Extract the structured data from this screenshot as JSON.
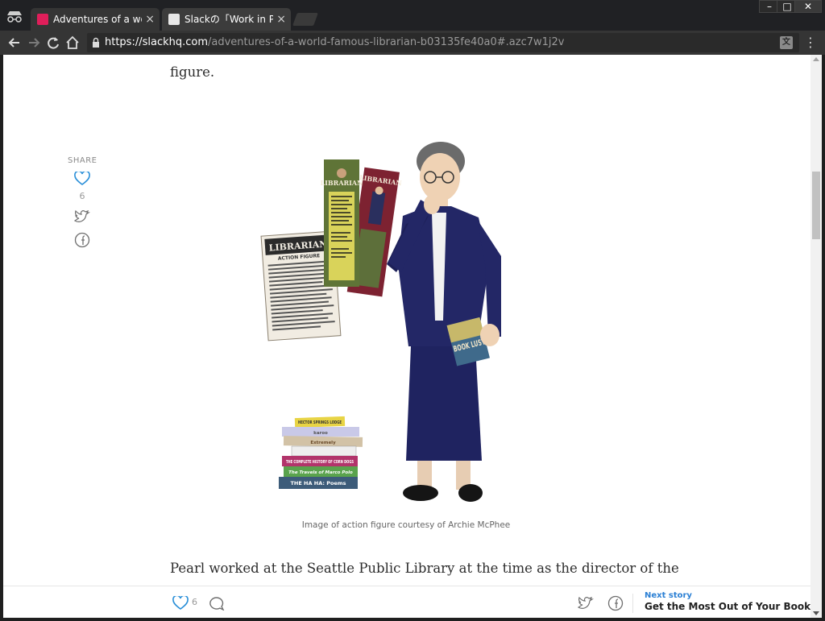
{
  "browser": {
    "tabs": [
      {
        "title": "Adventures of a world-famous librarian",
        "close": "×",
        "active": true
      },
      {
        "title": "Slackの「Work in Progress」",
        "close": "×",
        "active": false
      }
    ],
    "window_controls": {
      "minimize": "–",
      "maximize": "□",
      "close": "✕"
    },
    "url_host": "https://slackhq.com",
    "url_path": "/adventures-of-a-world-famous-librarian-b03135fe40a0#.azc7w1j2v"
  },
  "article": {
    "top_text": "figure.",
    "bottom_text": "Pearl worked at the Seattle Public Library at the time as the director of the",
    "caption": "Image of action figure courtesy of Archie McPhee"
  },
  "image": {
    "card_title": "LIBRARIAN",
    "card_subtitle": "ACTION FIGURE",
    "bookmark_title": "LIBRARIAN",
    "bookmark_title_2": "LIBRARIAN",
    "held_book_text": "BOOK LUST",
    "books": [
      "HECTOR SPRINGS LODGE",
      "karoo",
      "Extremely",
      "",
      "THE COMPLETE HISTORY OF CORN DOGS",
      "The Travels of Marco Polo",
      "THE HA HA: Poems"
    ]
  },
  "share": {
    "label": "SHARE",
    "count": "6"
  },
  "bottom_bar": {
    "like_count": "6",
    "next_label": "Next story",
    "next_title": "Get the Most Out of Your Books ..."
  },
  "colors": {
    "jacket": "#232766",
    "icon": "#6f6f6f",
    "heart": "#2a8fd8",
    "link": "#2a7fd4"
  }
}
